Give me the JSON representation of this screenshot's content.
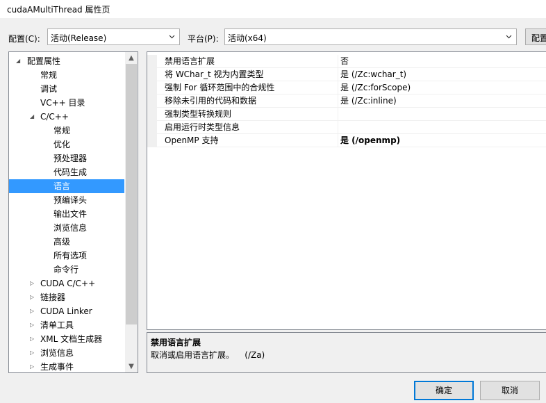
{
  "window": {
    "title": "cudaAMultiThread 属性页"
  },
  "config_bar": {
    "config_label": "配置(C):",
    "config_value": "活动(Release)",
    "platform_label": "平台(P):",
    "platform_value": "活动(x64)",
    "manager_button": "配置"
  },
  "tree": {
    "items": [
      {
        "label": "配置属性",
        "expander": "◢"
      },
      {
        "label": "常规",
        "expander": ""
      },
      {
        "label": "调试",
        "expander": ""
      },
      {
        "label": "VC++ 目录",
        "expander": ""
      },
      {
        "label": "C/C++",
        "expander": "◢"
      },
      {
        "label": "常规",
        "expander": ""
      },
      {
        "label": "优化",
        "expander": ""
      },
      {
        "label": "预处理器",
        "expander": ""
      },
      {
        "label": "代码生成",
        "expander": ""
      },
      {
        "label": "语言",
        "expander": ""
      },
      {
        "label": "预编译头",
        "expander": ""
      },
      {
        "label": "输出文件",
        "expander": ""
      },
      {
        "label": "浏览信息",
        "expander": ""
      },
      {
        "label": "高级",
        "expander": ""
      },
      {
        "label": "所有选项",
        "expander": ""
      },
      {
        "label": "命令行",
        "expander": ""
      },
      {
        "label": "CUDA C/C++",
        "expander": "▷"
      },
      {
        "label": "链接器",
        "expander": "▷"
      },
      {
        "label": "CUDA Linker",
        "expander": "▷"
      },
      {
        "label": "清单工具",
        "expander": "▷"
      },
      {
        "label": "XML 文档生成器",
        "expander": "▷"
      },
      {
        "label": "浏览信息",
        "expander": "▷"
      },
      {
        "label": "生成事件",
        "expander": "▷"
      }
    ],
    "selected_label": "语言",
    "scroll_up_icon": "▲",
    "scroll_down_icon": "▼"
  },
  "properties": {
    "rows": [
      {
        "name": "禁用语言扩展",
        "value": "否"
      },
      {
        "name": "将 WChar_t 视为内置类型",
        "value": "是 (/Zc:wchar_t)"
      },
      {
        "name": "强制 For 循环范围中的合规性",
        "value": "是 (/Zc:forScope)"
      },
      {
        "name": "移除未引用的代码和数据",
        "value": "是 (/Zc:inline)"
      },
      {
        "name": "强制类型转换规则",
        "value": ""
      },
      {
        "name": "启用运行时类型信息",
        "value": ""
      },
      {
        "name": "OpenMP 支持",
        "value": "是 (/openmp)"
      }
    ],
    "bold_value": "是 (/openmp)"
  },
  "description": {
    "title": "禁用语言扩展",
    "text": "取消或启用语言扩展。    (/Za)"
  },
  "buttons": {
    "ok": "确定",
    "cancel": "取消"
  },
  "colors": {
    "selection": "#3399ff",
    "default_button_border": "#0078d7"
  }
}
